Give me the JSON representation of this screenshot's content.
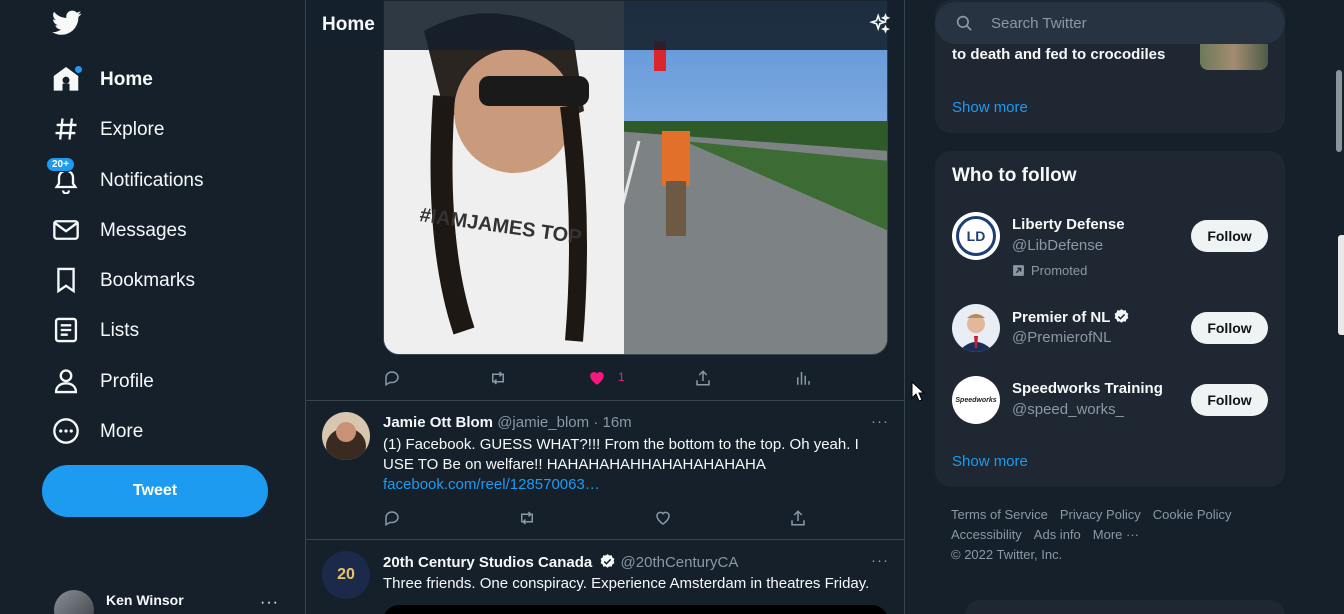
{
  "app": {
    "name": "Twitter",
    "accent": "#1d9bf0",
    "like_color": "#f91880"
  },
  "sidebar": {
    "logo_icon": "twitter-bird-icon",
    "nav": [
      {
        "label": "Home",
        "icon": "home-icon",
        "active": true
      },
      {
        "label": "Explore",
        "icon": "hashtag-icon"
      },
      {
        "label": "Notifications",
        "icon": "bell-icon",
        "badge": "20+"
      },
      {
        "label": "Messages",
        "icon": "envelope-icon"
      },
      {
        "label": "Bookmarks",
        "icon": "bookmark-icon"
      },
      {
        "label": "Lists",
        "icon": "list-icon"
      },
      {
        "label": "Profile",
        "icon": "person-icon"
      },
      {
        "label": "More",
        "icon": "more-circle-icon"
      }
    ],
    "tweet_button": "Tweet",
    "account": {
      "name": "Ken Winsor",
      "more": "···"
    }
  },
  "main": {
    "title": "Home",
    "top_tweet": {
      "photo_text": "#IAMJAMES TOP",
      "likes": "1"
    },
    "tweets": [
      {
        "name": "Jamie Ott Blom",
        "handle": "@jamie_blom",
        "time": "· 16m",
        "text": "(1) Facebook. GUESS WHAT?!!!  From the bottom to the top. Oh yeah. I USE TO Be on welfare!! HAHAHAHAHHAHAHAHAHAHA",
        "link": "facebook.com/reel/128570063…",
        "more": "···"
      },
      {
        "name": "20th Century Studios Canada",
        "handle": "@20thCenturyCA",
        "text": "Three friends. One conspiracy. Experience Amsterdam in theatres Friday.",
        "more": "···",
        "avatar_text": "20"
      }
    ]
  },
  "right": {
    "search_placeholder": "Search Twitter",
    "trend": {
      "text": "to death and fed to crocodiles",
      "show_more": "Show more"
    },
    "who_to_follow": {
      "title": "Who to follow",
      "users": [
        {
          "name": "Liberty Defense",
          "handle": "@LibDefense",
          "promoted": "Promoted",
          "follow": "Follow",
          "avatar_text": "LD"
        },
        {
          "name": "Premier of NL",
          "handle": "@PremierofNL",
          "verified": true,
          "follow": "Follow"
        },
        {
          "name": "Speedworks Training",
          "handle": "@speed_works_",
          "follow": "Follow",
          "avatar_text": "Speedworks"
        }
      ],
      "show_more": "Show more"
    },
    "footer": {
      "line1": [
        "Terms of Service",
        "Privacy Policy",
        "Cookie Policy"
      ],
      "line2": [
        "Accessibility",
        "Ads info",
        "More ···"
      ],
      "copyright": "© 2022 Twitter, Inc."
    }
  }
}
